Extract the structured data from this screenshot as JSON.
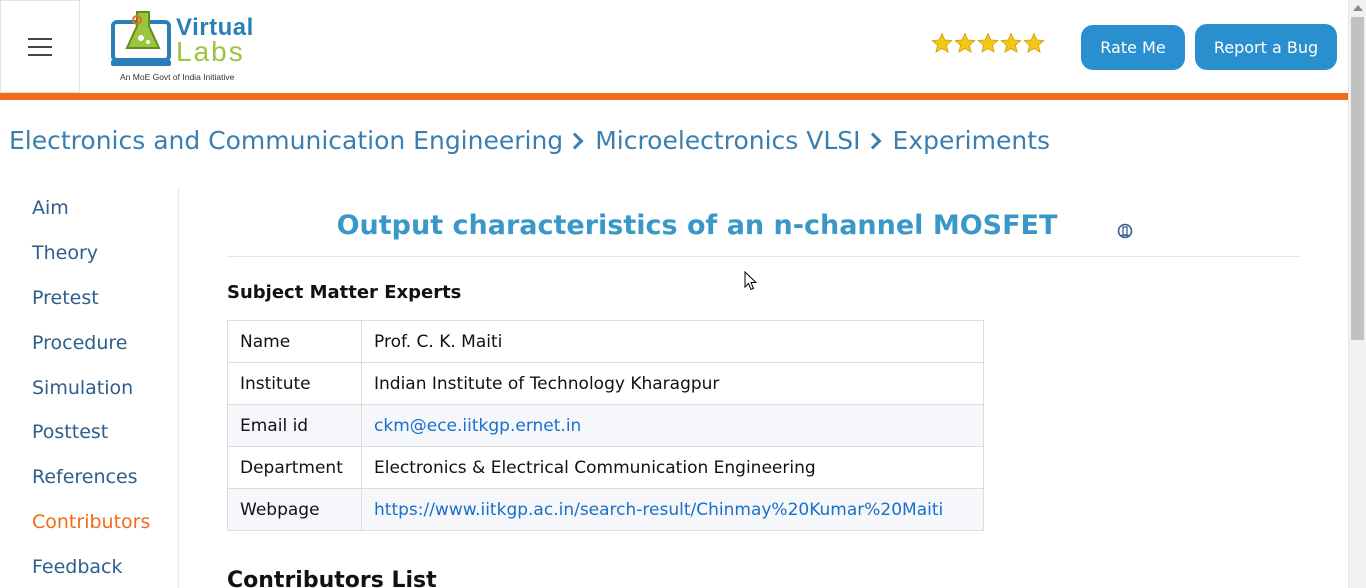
{
  "header": {
    "logo": {
      "word1": "Virtual",
      "word2": "Labs",
      "tagline": "An MoE Govt of India Initiative"
    },
    "rating": {
      "stars": 5,
      "max": 5,
      "color": "#f5c518"
    },
    "rate_button": "Rate Me",
    "bug_button": "Report a Bug",
    "accent_color": "#f26b1a",
    "button_color": "#2a8fcf"
  },
  "breadcrumb": [
    "Electronics and Communication Engineering",
    "Microelectronics VLSI",
    "Experiments"
  ],
  "sidebar": {
    "items": [
      {
        "label": "Aim"
      },
      {
        "label": "Theory"
      },
      {
        "label": "Pretest"
      },
      {
        "label": "Procedure"
      },
      {
        "label": "Simulation"
      },
      {
        "label": "Posttest"
      },
      {
        "label": "References"
      },
      {
        "label": "Contributors",
        "active": true
      },
      {
        "label": "Feedback"
      }
    ]
  },
  "main": {
    "title": "Output characteristics of an n-channel MOSFET",
    "title_icon": "iit-logo-icon",
    "section_experts": "Subject Matter Experts",
    "experts_table": [
      {
        "key": "Name",
        "value": "Prof. C. K. Maiti"
      },
      {
        "key": "Institute",
        "value": "Indian Institute of Technology Kharagpur"
      },
      {
        "key": "Email id",
        "value": "ckm@ece.iitkgp.ernet.in",
        "link": true
      },
      {
        "key": "Department",
        "value": "Electronics & Electrical Communication Engineering"
      },
      {
        "key": "Webpage",
        "value": "https://www.iitkgp.ac.in/search-result/Chinmay%20Kumar%20Maiti",
        "link": true
      }
    ],
    "section_contributors": "Contributors List"
  }
}
